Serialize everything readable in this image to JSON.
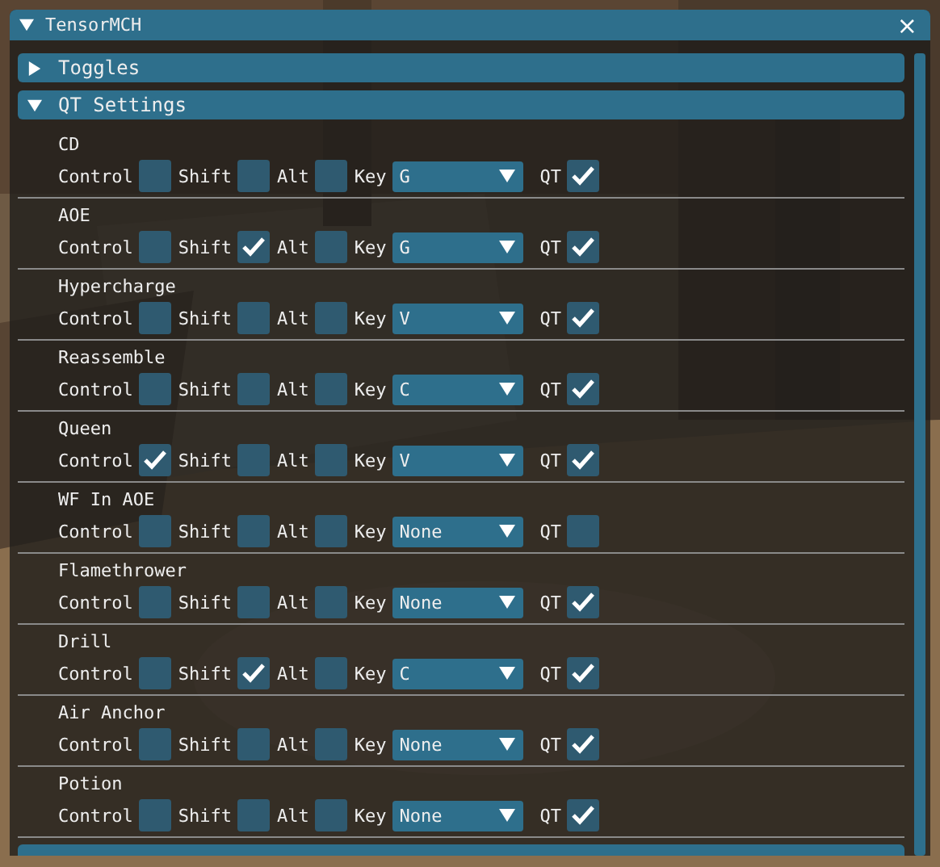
{
  "window": {
    "title": "TensorMCH",
    "close": "×"
  },
  "sections": [
    {
      "label": "Toggles",
      "expanded": false
    },
    {
      "label": "QT Settings",
      "expanded": true
    }
  ],
  "entries": [
    {
      "name": "CD",
      "control_label": "Control",
      "control": false,
      "shift_label": "Shift",
      "shift": false,
      "alt_label": "Alt",
      "alt": false,
      "key_label": "Key",
      "key": "G",
      "qt_label": "QT",
      "qt": true
    },
    {
      "name": "AOE",
      "control_label": "Control",
      "control": false,
      "shift_label": "Shift",
      "shift": true,
      "alt_label": "Alt",
      "alt": false,
      "key_label": "Key",
      "key": "G",
      "qt_label": "QT",
      "qt": true
    },
    {
      "name": "Hypercharge",
      "control_label": "Control",
      "control": false,
      "shift_label": "Shift",
      "shift": false,
      "alt_label": "Alt",
      "alt": false,
      "key_label": "Key",
      "key": "V",
      "qt_label": "QT",
      "qt": true
    },
    {
      "name": "Reassemble",
      "control_label": "Control",
      "control": false,
      "shift_label": "Shift",
      "shift": false,
      "alt_label": "Alt",
      "alt": false,
      "key_label": "Key",
      "key": "C",
      "qt_label": "QT",
      "qt": true
    },
    {
      "name": "Queen",
      "control_label": "Control",
      "control": true,
      "shift_label": "Shift",
      "shift": false,
      "alt_label": "Alt",
      "alt": false,
      "key_label": "Key",
      "key": "V",
      "qt_label": "QT",
      "qt": true
    },
    {
      "name": "WF In AOE",
      "control_label": "Control",
      "control": false,
      "shift_label": "Shift",
      "shift": false,
      "alt_label": "Alt",
      "alt": false,
      "key_label": "Key",
      "key": "None",
      "qt_label": "QT",
      "qt": false
    },
    {
      "name": "Flamethrower",
      "control_label": "Control",
      "control": false,
      "shift_label": "Shift",
      "shift": false,
      "alt_label": "Alt",
      "alt": false,
      "key_label": "Key",
      "key": "None",
      "qt_label": "QT",
      "qt": true
    },
    {
      "name": "Drill",
      "control_label": "Control",
      "control": false,
      "shift_label": "Shift",
      "shift": true,
      "alt_label": "Alt",
      "alt": false,
      "key_label": "Key",
      "key": "C",
      "qt_label": "QT",
      "qt": true
    },
    {
      "name": "Air Anchor",
      "control_label": "Control",
      "control": false,
      "shift_label": "Shift",
      "shift": false,
      "alt_label": "Alt",
      "alt": false,
      "key_label": "Key",
      "key": "None",
      "qt_label": "QT",
      "qt": true
    },
    {
      "name": "Potion",
      "control_label": "Control",
      "control": false,
      "shift_label": "Shift",
      "shift": false,
      "alt_label": "Alt",
      "alt": false,
      "key_label": "Key",
      "key": "None",
      "qt_label": "QT",
      "qt": true
    }
  ]
}
